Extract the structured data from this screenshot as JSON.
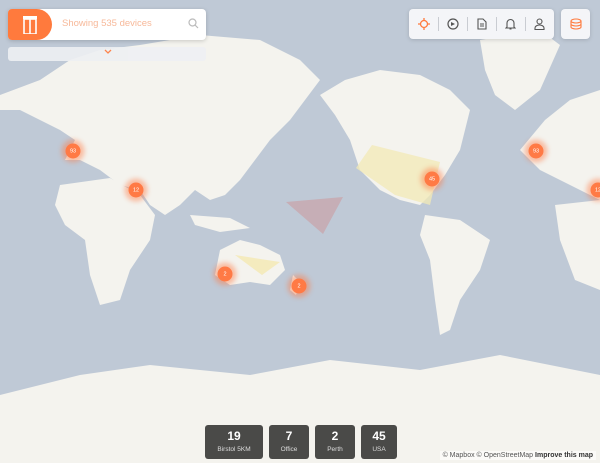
{
  "search": {
    "placeholder": "Showing 535 devices"
  },
  "toolbar": {
    "icons": [
      "locate-icon",
      "dashboard-icon",
      "report-icon",
      "bell-icon",
      "user-icon"
    ],
    "accent": "#ff7a3d"
  },
  "clusters": [
    {
      "label": "93",
      "region": "europe"
    },
    {
      "label": "12",
      "region": "middle-east"
    },
    {
      "label": "45",
      "region": "usa"
    },
    {
      "label": "93",
      "region": "europe-repeat"
    },
    {
      "label": "12",
      "region": "middle-east-repeat"
    },
    {
      "label": "2",
      "region": "perth"
    },
    {
      "label": "2",
      "region": "new-zealand"
    }
  ],
  "stats": [
    {
      "value": "19",
      "label": "Birstol 5KM"
    },
    {
      "value": "7",
      "label": "Office"
    },
    {
      "value": "2",
      "label": "Perth"
    },
    {
      "value": "45",
      "label": "USA"
    }
  ],
  "attribution": {
    "mapbox": "© Mapbox",
    "osm": "© OpenStreetMap",
    "improve": "Improve this map"
  },
  "colors": {
    "ocean": "#bfc9d6",
    "land": "#f4f3ee",
    "cluster": "#ff7a45",
    "zone_yellow": "#f3e9b5",
    "zone_red": "#c9a3a8"
  }
}
